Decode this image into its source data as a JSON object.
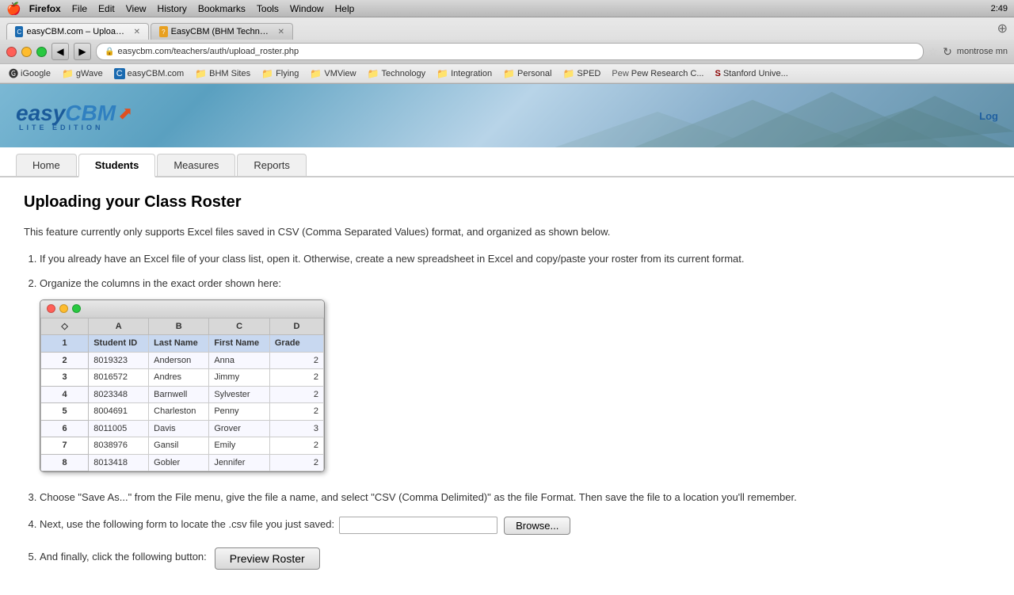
{
  "mac_bar": {
    "apple": "🍎",
    "menu_items": [
      "Firefox",
      "File",
      "Edit",
      "View",
      "History",
      "Bookmarks",
      "Tools",
      "Window",
      "Help"
    ],
    "right_text": "2:49"
  },
  "tabs": [
    {
      "label": "easyCBM.com – Uploading your ...",
      "active": true,
      "favicon": "cbm"
    },
    {
      "label": "EasyCBM (BHM Technology Help)",
      "active": false,
      "favicon": "help"
    }
  ],
  "url_bar": {
    "text": "easycbm.com/teachers/auth/upload_roster.php"
  },
  "browser_right": {
    "account": "montrose  mn"
  },
  "bookmarks": [
    {
      "label": "iGoogle",
      "icon": "google"
    },
    {
      "label": "gWave",
      "icon": "folder"
    },
    {
      "label": "easyCBM.com",
      "icon": "cbm"
    },
    {
      "label": "BHM Sites",
      "icon": "folder"
    },
    {
      "label": "Flying",
      "icon": "folder"
    },
    {
      "label": "VMView",
      "icon": "folder"
    },
    {
      "label": "Technology",
      "icon": "folder"
    },
    {
      "label": "Integration",
      "icon": "folder"
    },
    {
      "label": "Personal",
      "icon": "folder"
    },
    {
      "label": "SPED",
      "icon": "folder"
    },
    {
      "label": "Pew Research C...",
      "icon": "pew"
    },
    {
      "label": "Stanford Unive...",
      "icon": "stanford"
    }
  ],
  "header": {
    "logo_main": "easyCBM",
    "logo_sub": "LITE EDITION",
    "login_label": "Log"
  },
  "nav_tabs": [
    {
      "label": "Home",
      "active": false
    },
    {
      "label": "Students",
      "active": true
    },
    {
      "label": "Measures",
      "active": false
    },
    {
      "label": "Reports",
      "active": false
    }
  ],
  "page": {
    "title": "Uploading your Class Roster",
    "intro": "This feature currently only supports Excel files saved in CSV (Comma Separated Values) format, and organized as shown below.",
    "step1": "If you already have an Excel file of your class list, open it. Otherwise, create a new spreadsheet in Excel and copy/paste your roster from its current format.",
    "step2": "Organize the columns in the exact order shown here:",
    "step3": "Choose \"Save As...\" from the File menu, give the file a name, and select \"CSV (Comma Delimited)\" as the file Format. Then save the file to a location you'll remember.",
    "step4_prefix": "Next, use the following form to locate the .csv file you just saved:",
    "step5_prefix": "And finally, click the following button:",
    "browse_label": "Browse...",
    "preview_label": "Preview Roster",
    "file_placeholder": ""
  },
  "spreadsheet": {
    "col_headers": [
      "",
      "A",
      "B",
      "C",
      "D"
    ],
    "header_row": [
      "1",
      "Student ID",
      "Last Name",
      "First Name",
      "Grade"
    ],
    "rows": [
      [
        "2",
        "8019323",
        "Anderson",
        "Anna",
        "2"
      ],
      [
        "3",
        "8016572",
        "Andres",
        "Jimmy",
        "2"
      ],
      [
        "4",
        "8023348",
        "Barnwell",
        "Sylvester",
        "2"
      ],
      [
        "5",
        "8004691",
        "Charleston",
        "Penny",
        "2"
      ],
      [
        "6",
        "8011005",
        "Davis",
        "Grover",
        "3"
      ],
      [
        "7",
        "8038976",
        "Gansil",
        "Emily",
        "2"
      ],
      [
        "8",
        "8013418",
        "Gobler",
        "Jennifer",
        "2"
      ]
    ]
  }
}
